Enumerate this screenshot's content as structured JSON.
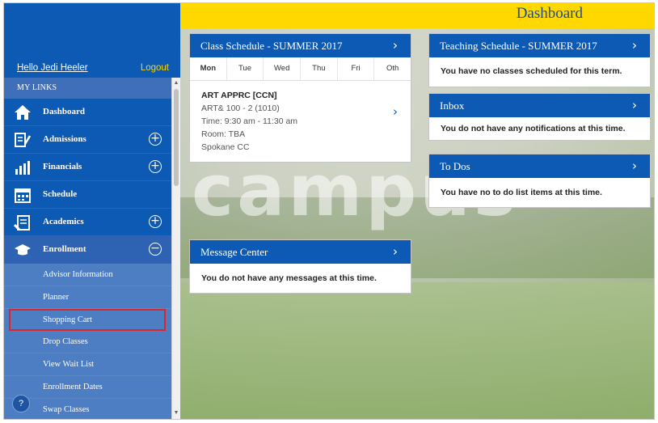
{
  "header": {
    "title": "Dashboard"
  },
  "sidebar": {
    "greeting": "Hello Jedi Heeler",
    "logout": "Logout",
    "section_title": "MY LINKS",
    "items": [
      {
        "label": "Dashboard",
        "icon": "home-icon",
        "expand": ""
      },
      {
        "label": "Admissions",
        "icon": "admissions-icon",
        "expand": "+"
      },
      {
        "label": "Financials",
        "icon": "financials-icon",
        "expand": "+"
      },
      {
        "label": "Schedule",
        "icon": "calendar-icon",
        "expand": ""
      },
      {
        "label": "Academics",
        "icon": "academics-icon",
        "expand": "+"
      },
      {
        "label": "Enrollment",
        "icon": "graduation-cap-icon",
        "expand": "−"
      }
    ],
    "enrollment_sub": [
      "Advisor Information",
      "Planner",
      "Shopping Cart",
      "Drop Classes",
      "View Wait List",
      "Enrollment Dates",
      "Swap Classes"
    ],
    "help": "?"
  },
  "background_word": "campus",
  "class_schedule": {
    "title": "Class Schedule - SUMMER 2017",
    "tabs": [
      "Mon",
      "Tue",
      "Wed",
      "Thu",
      "Fri",
      "Oth"
    ],
    "class": {
      "name": "ART APPRC [CCN]",
      "section": "ART& 100 - 2 (1010)",
      "time": "Time: 9:30 am - 11:30 am",
      "room": "Room: TBA",
      "campus": "Spokane CC"
    }
  },
  "teaching_schedule": {
    "title": "Teaching Schedule - SUMMER 2017",
    "message": "You have no classes scheduled for this term."
  },
  "inbox": {
    "title": "Inbox",
    "message": "You do not have any notifications at this time."
  },
  "todos": {
    "title": "To Dos",
    "message": "You have no to do list items at this time."
  },
  "message_center": {
    "title": "Message Center",
    "message": "You do not have any messages at this time."
  },
  "chevron": "›"
}
